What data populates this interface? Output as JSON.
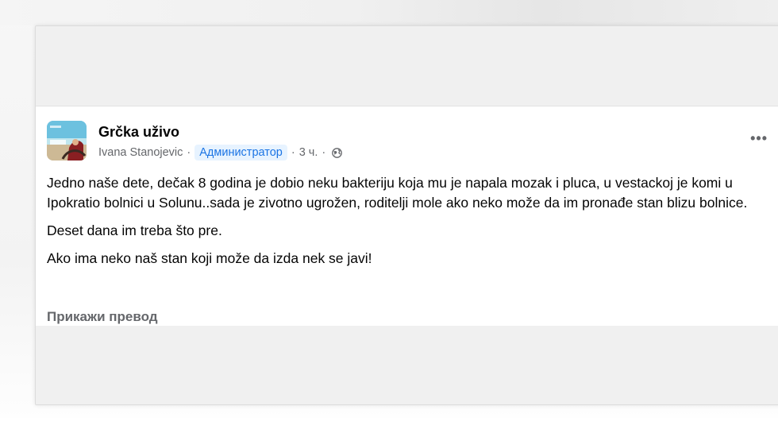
{
  "post": {
    "group_name": "Grčka uživo",
    "author": "Ivana Stanojevic",
    "separator": "·",
    "role": "Администратор",
    "time": "3 ч.",
    "privacy_icon": "globe-icon",
    "more_label": "•••",
    "paragraphs": [
      "Jedno naše dete, dečak 8 godina je dobio neku bakteriju koja mu je napala mozak i pluca, u vestackoj je komi u Ipokratio bolnici u Solunu..sada je zivotno ugrožen, roditelji mole ako neko može da im pronađe stan blizu bolnice.",
      "Deset dana im treba što pre.",
      "Ako ima neko naš stan koji može da izda nek se javi!"
    ],
    "translate_label": "Прикажи превод"
  },
  "colors": {
    "role_badge_bg": "#e7f3ff",
    "role_badge_text": "#1b74e4",
    "meta_text": "#65676b",
    "body_text": "#050505"
  }
}
